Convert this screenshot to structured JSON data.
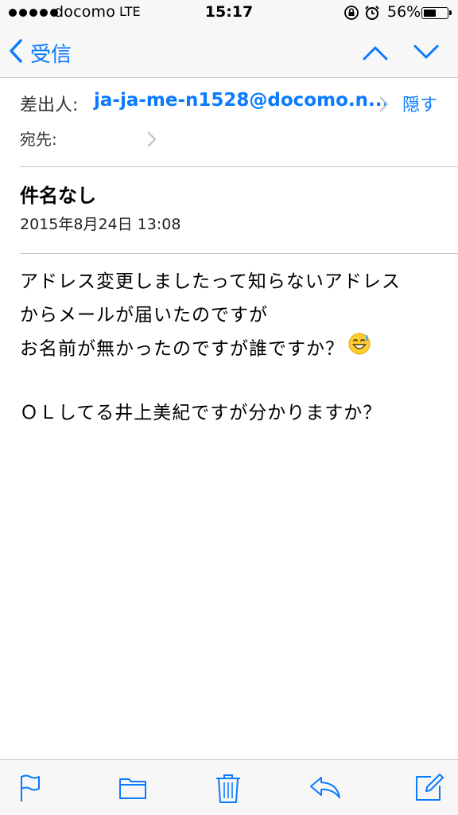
{
  "status_bar": {
    "carrier": "docomo",
    "network": "LTE",
    "time": "15:17",
    "battery_percent": "56%",
    "battery_level": 0.56
  },
  "nav": {
    "back_label": "受信",
    "icons": [
      "chevron-left-icon",
      "chevron-up-icon",
      "chevron-down-icon"
    ]
  },
  "header": {
    "from_label": "差出人:",
    "from_address": "ja-ja-me-n1528@docomo.n...",
    "hide_label": "隠す",
    "to_label": "宛先:"
  },
  "message": {
    "subject": "件名なし",
    "date": "2015年8月24日 13:08",
    "body": {
      "line1": "アドレス変更しましたって知らないアドレス",
      "line2": "からメールが届いたのですが",
      "line3": "お名前が無かったのですが誰ですか？",
      "line4": "ＯＬしてる井上美紀ですが分かりますか？"
    }
  },
  "toolbar": {
    "icons": [
      "flag-icon",
      "folder-icon",
      "trash-icon",
      "reply-icon",
      "compose-icon"
    ]
  },
  "colors": {
    "accent": "#0a7aff",
    "bar_background": "#f7f7f7",
    "divider": "#c8c7cc"
  }
}
